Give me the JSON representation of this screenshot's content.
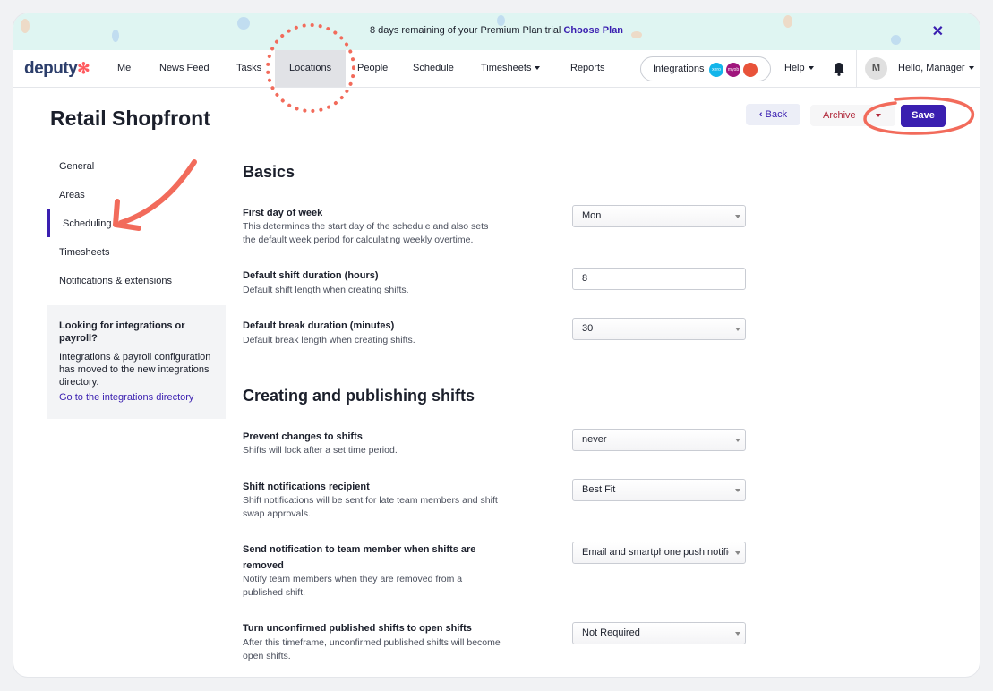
{
  "banner": {
    "text": "8 days remaining of your Premium Plan trial",
    "cta": "Choose Plan",
    "close": "✕"
  },
  "nav": {
    "logo": "deputy",
    "items": [
      "Me",
      "News Feed",
      "Tasks",
      "Locations",
      "People",
      "Schedule",
      "Timesheets",
      "Reports"
    ],
    "active": "Locations",
    "integrations": "Integrations",
    "integration_badges": [
      "xero",
      "myob",
      ""
    ],
    "help": "Help",
    "avatar_initial": "M",
    "user": "Hello, Manager"
  },
  "page": {
    "title": "Retail Shopfront",
    "back": "Back",
    "archive": "Archive",
    "save": "Save"
  },
  "sidebar": {
    "items": [
      "General",
      "Areas",
      "Scheduling",
      "Timesheets",
      "Notifications & extensions"
    ],
    "active": "Scheduling",
    "box": {
      "heading": "Looking for integrations or payroll?",
      "text": "Integrations & payroll configuration has moved to the new integrations directory.",
      "link": "Go to the integrations directory"
    }
  },
  "basics": {
    "title": "Basics",
    "first_day": {
      "label": "First day of week",
      "desc": "This determines the start day of the schedule and also sets the default week period for calculating weekly overtime.",
      "value": "Mon"
    },
    "shift_duration": {
      "label": "Default shift duration (hours)",
      "desc": "Default shift length when creating shifts.",
      "value": "8"
    },
    "break_duration": {
      "label": "Default break duration (minutes)",
      "desc": "Default break length when creating shifts.",
      "value": "30"
    }
  },
  "publishing": {
    "title": "Creating and publishing shifts",
    "prevent_changes": {
      "label": "Prevent changes to shifts",
      "desc": "Shifts will lock after a set time period.",
      "value": "never"
    },
    "notif_recipient": {
      "label": "Shift notifications recipient",
      "desc": "Shift notifications will be sent for late team members and shift swap approvals.",
      "value": "Best Fit"
    },
    "notif_removed": {
      "label": "Send notification to team member when shifts are removed",
      "desc": "Notify team members when they are removed from a published shift.",
      "value": "Email and smartphone push notifications"
    },
    "unconfirmed": {
      "label": "Turn unconfirmed published shifts to open shifts",
      "desc": "After this timeframe, unconfirmed published shifts will become open shifts.",
      "value": "Not Required"
    }
  },
  "colors": {
    "accent": "#3a1fb0",
    "annotation": "#f26b5b",
    "banner": "#dff5f2"
  }
}
